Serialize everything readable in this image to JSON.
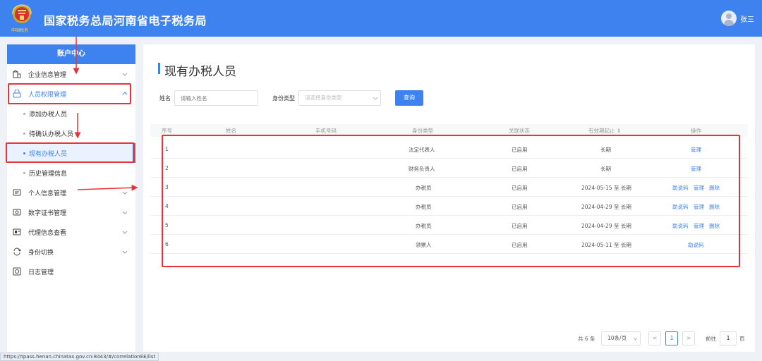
{
  "header": {
    "title": "国家税务总局河南省电子税务局",
    "user_name": "张三",
    "emblem_text": "中国税务"
  },
  "sidebar": {
    "header": "账户中心",
    "items": [
      {
        "label": "企业信息管理",
        "icon": "building-icon"
      },
      {
        "label": "人员权限管理",
        "icon": "user-lock-icon"
      },
      {
        "label": "个人信息管理",
        "icon": "id-card-icon"
      },
      {
        "label": "数字证书管理",
        "icon": "certificate-icon"
      },
      {
        "label": "代理信息查看",
        "icon": "agent-icon"
      },
      {
        "label": "身份切换",
        "icon": "switch-icon"
      },
      {
        "label": "日志管理",
        "icon": "log-icon"
      }
    ],
    "sub_items": [
      {
        "label": "添加办税人员"
      },
      {
        "label": "待确认办税人员"
      },
      {
        "label": "现有办税人员"
      },
      {
        "label": "历史管理信息"
      }
    ]
  },
  "main": {
    "title": "现有办税人员",
    "filters": {
      "name_label": "姓名",
      "name_placeholder": "请输入姓名",
      "type_label": "身份类型",
      "type_placeholder": "请选择身份类型",
      "query_label": "查询"
    },
    "table": {
      "columns": [
        "序号",
        "姓名",
        "手机号码",
        "身份类型",
        "关联状态",
        "有效期起止 ⇕",
        "操作"
      ],
      "rows": [
        {
          "no": "1",
          "type": "法定代表人",
          "status": "已启用",
          "period": "长期",
          "ops": [
            "管理"
          ]
        },
        {
          "no": "2",
          "type": "财务负责人",
          "status": "已启用",
          "period": "长期",
          "ops": [
            "管理"
          ]
        },
        {
          "no": "3",
          "type": "办税员",
          "status": "已启用",
          "period": "2024-05-15 至 长期",
          "ops": [
            "助说码",
            "管理",
            "删除"
          ]
        },
        {
          "no": "4",
          "type": "办税员",
          "status": "已启用",
          "period": "2024-04-29 至 长期",
          "ops": [
            "助说码",
            "管理",
            "删除"
          ]
        },
        {
          "no": "5",
          "type": "办税员",
          "status": "已启用",
          "period": "2024-04-29 至 长期",
          "ops": [
            "助说码",
            "管理",
            "删除"
          ]
        },
        {
          "no": "6",
          "type": "领票人",
          "status": "已启用",
          "period": "2024-05-11 至 长期",
          "ops": [
            "助说码"
          ]
        }
      ]
    },
    "pagination": {
      "total": "共 6 条",
      "page_size": "10条/页",
      "prev": "<",
      "current": "1",
      "next": ">",
      "goto_label": "前往",
      "goto_value": "1",
      "page_unit": "页"
    }
  },
  "status_url": "https://tpass.henan.chinatax.gov.cn:8443/#/correlationEE/list",
  "colors": {
    "brand": "#3e82f0",
    "annotation": "#e8333b"
  }
}
